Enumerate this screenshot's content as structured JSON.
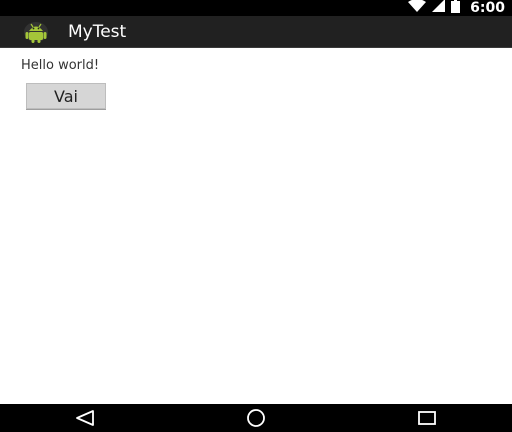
{
  "status_bar": {
    "time": "6:00",
    "icons": [
      "wifi-icon",
      "signal-icon",
      "battery-icon"
    ]
  },
  "action_bar": {
    "app_icon": "android-icon",
    "title": "MyTest"
  },
  "content": {
    "text": "Hello world!",
    "button_label": "Vai"
  },
  "nav_bar": {
    "icons": [
      "back-icon",
      "home-icon",
      "recents-icon"
    ]
  },
  "colors": {
    "status_bar": "#000000",
    "action_bar": "#212121",
    "android_green": "#a4c639",
    "button_bg": "#d6d6d6"
  }
}
